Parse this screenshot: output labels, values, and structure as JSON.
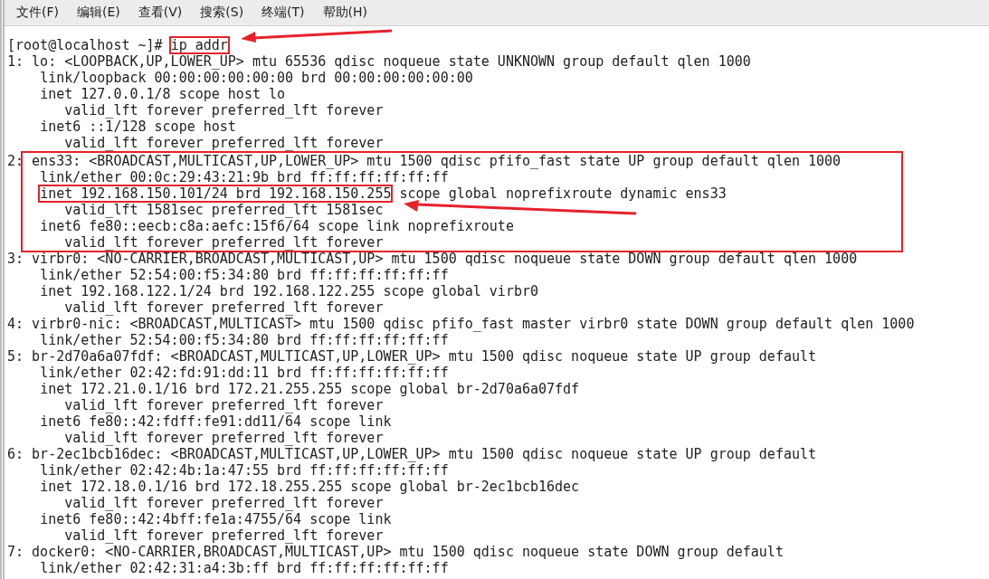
{
  "menu": [
    "文件(F)",
    "编辑(E)",
    "查看(V)",
    "搜索(S)",
    "终端(T)",
    "帮助(H)"
  ],
  "prompt": {
    "text": "[root@localhost ~]#",
    "command": "ip addr"
  },
  "output_before": [
    "1: lo: <LOOPBACK,UP,LOWER_UP> mtu 65536 qdisc noqueue state UNKNOWN group default qlen 1000",
    "    link/loopback 00:00:00:00:00:00 brd 00:00:00:00:00:00",
    "    inet 127.0.0.1/8 scope host lo",
    "       valid_lft forever preferred_lft forever",
    "    inet6 ::1/128 scope host",
    "       valid_lft forever preferred_lft forever"
  ],
  "highlighted_output": [
    {
      "text": "2: ens33: <BROADCAST,MULTICAST,UP,LOWER_UP> mtu 1500 qdisc pfifo_fast state UP group default qlen 1000"
    },
    {
      "text": "    link/ether 00:0c:29:43:21:9b brd ff:ff:ff:ff:ff:ff"
    },
    {
      "marked": "    inet 192.168.150.101/24 brd 192.168.150.255",
      "text": " scope global noprefixroute dynamic ens33"
    },
    {
      "text": "       valid_lft 1581sec preferred_lft 1581sec"
    },
    {
      "text": "    inet6 fe80::eecb:c8a:aefc:15f6/64 scope link noprefixroute"
    },
    {
      "text": "       valid_lft forever preferred_lft forever"
    }
  ],
  "output_after": [
    "3: virbr0: <NO-CARRIER,BROADCAST,MULTICAST,UP> mtu 1500 qdisc noqueue state DOWN group default qlen 1000",
    "    link/ether 52:54:00:f5:34:80 brd ff:ff:ff:ff:ff:ff",
    "    inet 192.168.122.1/24 brd 192.168.122.255 scope global virbr0",
    "       valid_lft forever preferred_lft forever",
    "4: virbr0-nic: <BROADCAST,MULTICAST> mtu 1500 qdisc pfifo_fast master virbr0 state DOWN group default qlen 1000",
    "    link/ether 52:54:00:f5:34:80 brd ff:ff:ff:ff:ff:ff",
    "5: br-2d70a6a07fdf: <BROADCAST,MULTICAST,UP,LOWER_UP> mtu 1500 qdisc noqueue state UP group default",
    "    link/ether 02:42:fd:91:dd:11 brd ff:ff:ff:ff:ff:ff",
    "    inet 172.21.0.1/16 brd 172.21.255.255 scope global br-2d70a6a07fdf",
    "       valid_lft forever preferred_lft forever",
    "    inet6 fe80::42:fdff:fe91:dd11/64 scope link",
    "       valid_lft forever preferred_lft forever",
    "6: br-2ec1bcb16dec: <BROADCAST,MULTICAST,UP,LOWER_UP> mtu 1500 qdisc noqueue state UP group default",
    "    link/ether 02:42:4b:1a:47:55 brd ff:ff:ff:ff:ff:ff",
    "    inet 172.18.0.1/16 brd 172.18.255.255 scope global br-2ec1bcb16dec",
    "       valid_lft forever preferred_lft forever",
    "    inet6 fe80::42:4bff:fe1a:4755/64 scope link",
    "       valid_lft forever preferred_lft forever",
    "7: docker0: <NO-CARRIER,BROADCAST,MULTICAST,UP> mtu 1500 qdisc noqueue state DOWN group default",
    "    link/ether 02:42:31:a4:3b:ff brd ff:ff:ff:ff:ff:ff"
  ]
}
